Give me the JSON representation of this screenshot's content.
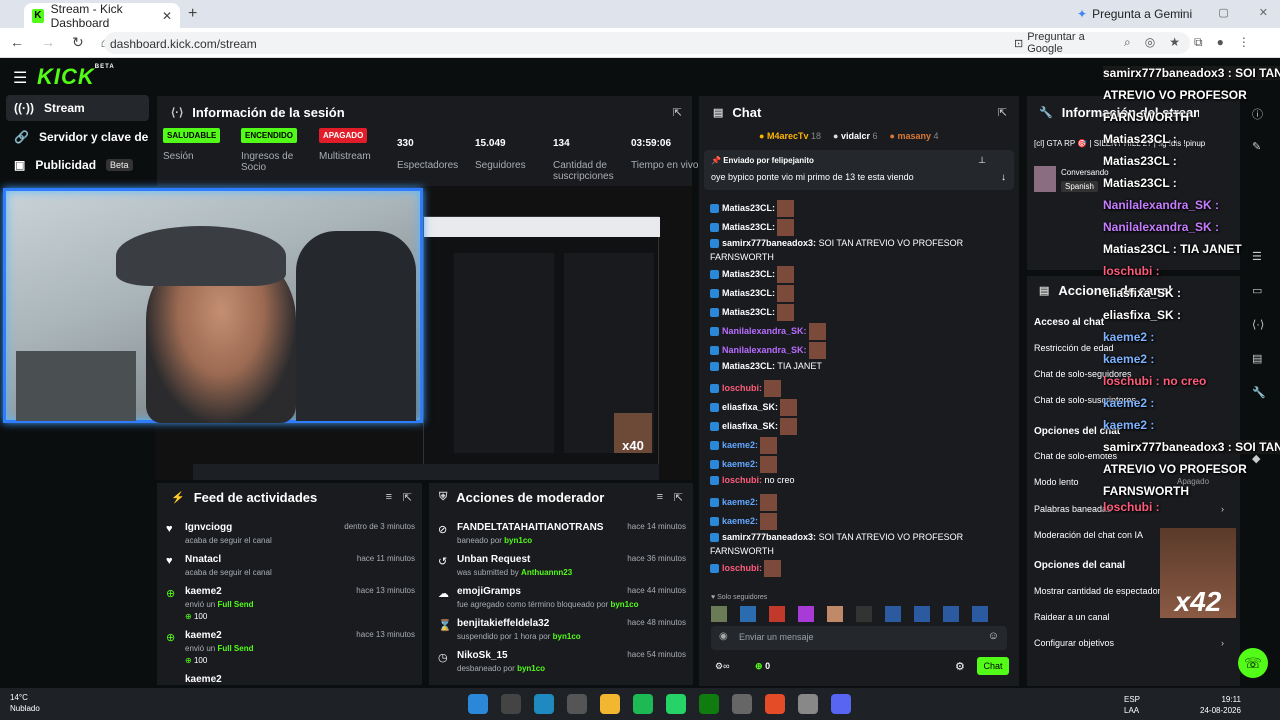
{
  "browser": {
    "tab_title": "Stream - Kick Dashboard",
    "tab_favicon": "K",
    "new_tab": "+",
    "gemini": "Pregunta a Gemini",
    "url": "dashboard.kick.com/stream",
    "ask_google": "Preguntar a Google"
  },
  "brand": {
    "logo": "KICK",
    "beta_tag": "BETA",
    "accent": "#53fc18"
  },
  "sidebar": {
    "items": [
      {
        "label": "Stream"
      },
      {
        "label": "Servidor y clave de retransmisión"
      },
      {
        "label": "Publicidad",
        "badge": "Beta"
      }
    ]
  },
  "session": {
    "title": "Información de la sesión",
    "stats": [
      {
        "badge": "SALUDABLE",
        "label": "Sesión"
      },
      {
        "badge": "ENCENDIDO",
        "label": "Ingresos de Socio"
      },
      {
        "badge": "APAGADO",
        "label": "Multistream"
      },
      {
        "value": "330",
        "label": "Espectadores"
      },
      {
        "value": "15.049",
        "label": "Seguidores"
      },
      {
        "value": "134",
        "label": "Cantidad de suscripciones"
      },
      {
        "value": "03:59:06",
        "label": "Tiempo en vivo"
      }
    ]
  },
  "video": {
    "multiplier": "x40"
  },
  "feed": {
    "title": "Feed de actividades",
    "items": [
      {
        "name": "Ignvciogg",
        "sub": "acaba de seguir el canal",
        "time": "dentro de 3 minutos"
      },
      {
        "name": "Nnatacl",
        "sub": "acaba de seguir el canal",
        "time": "hace 11 minutos"
      },
      {
        "name": "kaeme2",
        "sub_pre": "envió un",
        "sub_b": "Full Send",
        "pts": "100",
        "time": "hace 13 minutos"
      },
      {
        "name": "kaeme2",
        "sub_pre": "envió un",
        "sub_b": "Full Send",
        "pts": "100",
        "time": "hace 13 minutos"
      },
      {
        "name": "kaeme2"
      }
    ]
  },
  "moderator": {
    "title": "Acciones de moderador",
    "items": [
      {
        "name": "FANDELTATAHAITIANOTRANS",
        "sub_pre": "baneado por",
        "sub_b": "byn1co",
        "time": "hace 14 minutos"
      },
      {
        "name": "Unban Request",
        "sub_pre": "was submitted by",
        "sub_b": "Anthuannn23",
        "time": "hace 36 minutos"
      },
      {
        "name": "emojiGramps",
        "sub_pre": "fue agregado como término bloqueado por",
        "sub_b": "byn1co",
        "time": "hace 44 minutos"
      },
      {
        "name": "benjitakieffeldela32",
        "sub_pre": "suspendido por 1 hora por",
        "sub_b": "byn1co",
        "time": "hace 48 minutos"
      },
      {
        "name": "NikoSk_15",
        "sub_pre": "desbaneado por",
        "sub_b": "byn1co",
        "time": "hace 54 minutos"
      }
    ]
  },
  "chat": {
    "title": "Chat",
    "top": [
      {
        "name": "M4arecTv",
        "n": "18"
      },
      {
        "name": "vidalcr",
        "n": "6"
      },
      {
        "name": "masany",
        "n": "4"
      }
    ],
    "pinned_label": "Enviado por",
    "pinned_by": "felipejanito",
    "pinned_text": "oye bypico ponte vio mi primo de 13 te esta viendo",
    "messages": [
      {
        "user": "Matias23CL:",
        "emote": true,
        "color": "#ffffff"
      },
      {
        "user": "Matias23CL:",
        "emote": true,
        "color": "#ffffff"
      },
      {
        "user": "samirx777baneadox3:",
        "text": " SOI TAN ATREVIO VO PROFESOR",
        "color": "#ffffff"
      },
      {
        "text2": "FARNSWORTH"
      },
      {
        "user": "Matias23CL:",
        "emote": true,
        "color": "#ffffff"
      },
      {
        "user": "Matias23CL:",
        "emote": true,
        "color": "#ffffff"
      },
      {
        "user": "Matias23CL:",
        "emote": true,
        "color": "#ffffff"
      },
      {
        "user": "Nanilalexandra_SK:",
        "emote": true,
        "color": "#b96cff"
      },
      {
        "user": "Nanilalexandra_SK:",
        "emote": true,
        "color": "#b96cff"
      },
      {
        "user": "Matias23CL:",
        "text": " TIA JANET",
        "color": "#ffffff"
      },
      {
        "user": "loschubi:",
        "emote": true,
        "color": "#ff5b7a"
      },
      {
        "user": "eliasfixa_SK:",
        "emote": true,
        "color": "#ffffff"
      },
      {
        "user": "eliasfixa_SK:",
        "emote": true,
        "color": "#ffffff"
      },
      {
        "user": "kaeme2:",
        "emote": true,
        "color": "#63a7ff"
      },
      {
        "user": "kaeme2:",
        "emote": true,
        "color": "#63a7ff"
      },
      {
        "user": "loschubi:",
        "text": " no creo",
        "color": "#ff5b7a"
      },
      {
        "user": "kaeme2:",
        "emote": true,
        "color": "#63a7ff"
      },
      {
        "user": "kaeme2:",
        "emote": true,
        "color": "#63a7ff"
      },
      {
        "user": "samirx777baneadox3:",
        "text": " SOI TAN ATREVIO VO PROFESOR",
        "color": "#ffffff"
      },
      {
        "text2": "FARNSWORTH"
      },
      {
        "user": "loschubi:",
        "emote": true,
        "color": "#ff5b7a"
      }
    ],
    "followers_only": "Solo seguidores",
    "input_placeholder": "Enviar un mensaje",
    "points": "0",
    "send": "Chat"
  },
  "info": {
    "title": "Información del stream",
    "stream_title": "[cl] GTA RP 🎯 | SILENT HILL 2? | !ig !dis !pinup",
    "category": "Conversando",
    "language": "Spanish"
  },
  "actions": {
    "title": "Acciones de canal",
    "sections": [
      {
        "head": "Acceso al chat",
        "rows": [
          "Restricción de edad",
          "Chat de solo-seguidores",
          "Chat de solo-suscriptores"
        ]
      },
      {
        "head": "Opciones del chat",
        "rows": [
          "Chat de solo-emotes",
          "Modo lento",
          "Palabras baneadas",
          "Moderación del chat con IA"
        ]
      },
      {
        "head": "Opciones del canal",
        "rows": [
          "Mostrar cantidad de espectadores",
          "Raidear a un canal",
          "Configurar objetivos"
        ]
      }
    ],
    "slow_value": "Apagado"
  },
  "overlay": {
    "lines": [
      "samirx777baneadox3 : SOI TAN",
      "ATREVIO VO PROFESOR",
      "FARNSWORTH",
      "Matias23CL :",
      "Matias23CL :",
      "Matias23CL :",
      "Nanilalexandra_SK :",
      "Nanilalexandra_SK :",
      "Matias23CL : TIA JANET",
      "loschubi :",
      "eliasfixa_SK :",
      "eliasfixa_SK :",
      "kaeme2 :",
      "kaeme2 :",
      "loschubi : no creo",
      "kaeme2 :",
      "kaeme2 :",
      "samirx777baneadox3 : SOI TAN",
      "ATREVIO VO PROFESOR",
      "FARNSWORTH",
      "loschubi :"
    ],
    "multiplier": "x42"
  },
  "taskbar": {
    "temp": "14°C",
    "weather": "Nublado",
    "lang1": "ESP",
    "lang2": "LAA",
    "time": "19:11",
    "date": "24-08-2026"
  }
}
